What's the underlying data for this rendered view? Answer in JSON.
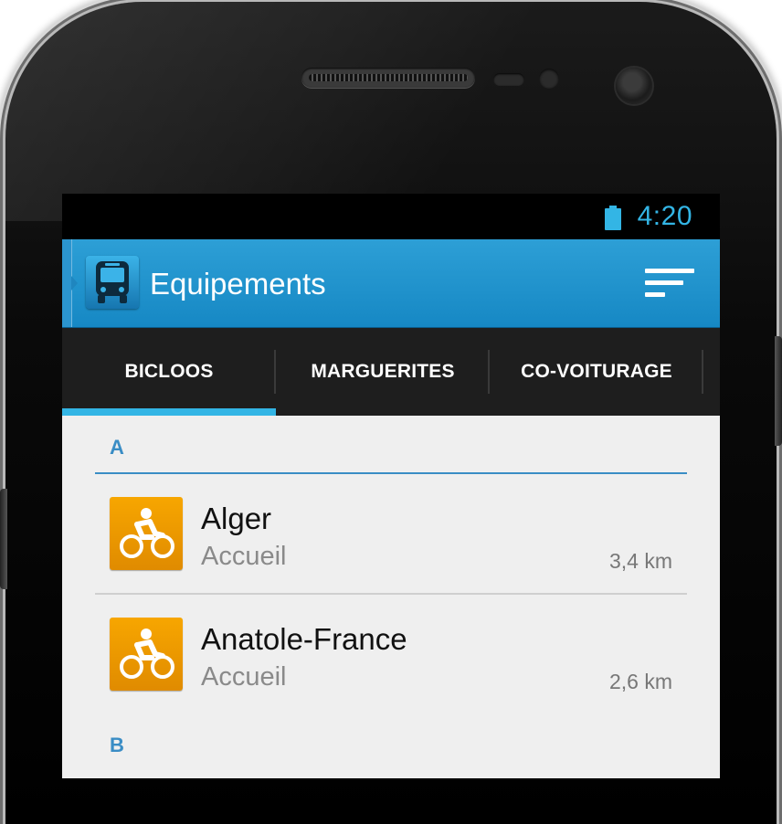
{
  "status_bar": {
    "time": "4:20"
  },
  "action_bar": {
    "title": "Equipements"
  },
  "tabs": [
    {
      "label": "BICLOOS",
      "active": true
    },
    {
      "label": "MARGUERITES",
      "active": false
    },
    {
      "label": "CO-VOITURAGE",
      "active": false
    }
  ],
  "sections": [
    {
      "letter": "A",
      "items": [
        {
          "name": "Alger",
          "category": "Accueil",
          "distance": "3,4 km"
        },
        {
          "name": "Anatole-France",
          "category": "Accueil",
          "distance": "2,6 km"
        }
      ]
    },
    {
      "letter": "B"
    }
  ],
  "colors": {
    "accent": "#33b5e5",
    "action_bar": "#1688c4",
    "section_header": "#3a8dc5",
    "bike_icon": "#f0a000"
  },
  "icons": {
    "app": "bus-icon",
    "overflow": "sort-menu-icon",
    "item": "bicycle-icon",
    "status": "battery-icon"
  }
}
